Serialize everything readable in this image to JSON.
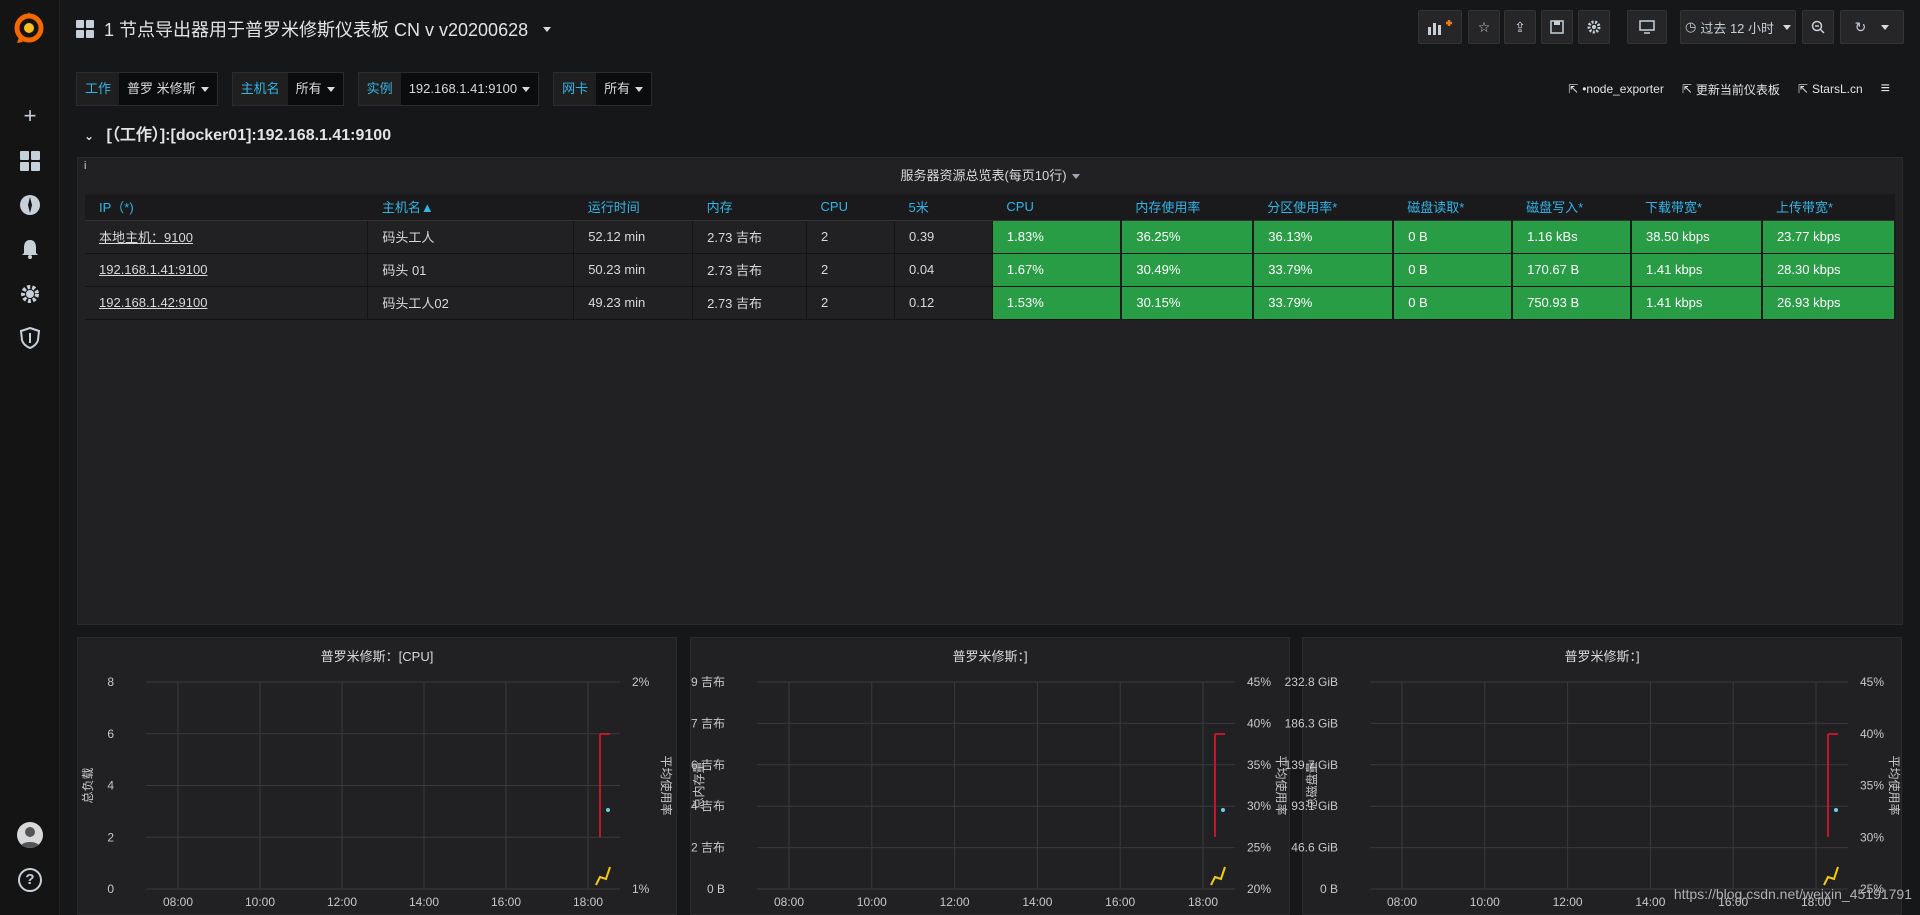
{
  "nav": {
    "title": "1 节点导出器用于普罗米修斯仪表板 CN v v20200628",
    "time_range": "过去 12 小时"
  },
  "variables": [
    {
      "label": "工作",
      "value": "普罗 米修斯"
    },
    {
      "label": "主机名",
      "value": "所有"
    },
    {
      "label": "实例",
      "value": "192.168.1.41:9100"
    },
    {
      "label": "网卡",
      "value": "所有"
    }
  ],
  "links": {
    "node_exporter": "•node_exporter",
    "update_dashboard": "更新当前仪表板",
    "starsl": "StarsL.cn"
  },
  "row_title": "[（工作）]:[docker01]:192.168.1.41:9100",
  "table_panel": {
    "title": "服务器资源总览表(每页10行)",
    "info_icon": "i",
    "headers": [
      "IP（*)",
      "主机名▲",
      "运行时间",
      "内存",
      "CPU",
      "5米",
      "CPU",
      "内存使用率",
      "分区使用率*",
      "磁盘读取*",
      "磁盘写入*",
      "下载带宽*",
      "上传带宽*"
    ],
    "rows": [
      [
        "本地主机：9100",
        "码头工人",
        "52.12 min",
        "2.73 吉布",
        "2",
        "0.39",
        "1.83%",
        "36.25%",
        "36.13%",
        "0 B",
        "1.16 kBs",
        "38.50 kbps",
        "23.77 kbps"
      ],
      [
        "192.168.1.41:9100",
        "码头 01",
        "50.23 min",
        "2.73 吉布",
        "2",
        "0.04",
        "1.67%",
        "30.49%",
        "33.79%",
        "0 B",
        "170.67 B",
        "1.41 kbps",
        "28.30 kbps"
      ],
      [
        "192.168.1.42:9100",
        "码头工人02",
        "49.23 min",
        "2.73 吉布",
        "2",
        "0.12",
        "1.53%",
        "30.15%",
        "33.79%",
        "0 B",
        "750.93 B",
        "1.41 kbps",
        "26.93 kbps"
      ]
    ],
    "status_color": "#299c46"
  },
  "charts": [
    {
      "title": "普罗米修斯：[CPU]",
      "left_label": "总负载",
      "right_label": "平均使用率",
      "left_ticks": [
        "8",
        "6",
        "4",
        "2",
        "0"
      ],
      "right_ticks": [
        "2%",
        "1%"
      ],
      "x_ticks": [
        "08:00",
        "10:00",
        "12:00",
        "14:00",
        "16:00",
        "18:00"
      ]
    },
    {
      "title": "普罗米修斯：]",
      "left_label": "总内存量",
      "right_label": "平均使用率",
      "left_ticks": [
        "9 吉布",
        "7 吉布",
        "6 吉布",
        "4 吉布",
        "2 吉布",
        "0 B"
      ],
      "right_ticks": [
        "45%",
        "40%",
        "35%",
        "30%",
        "25%",
        "20%"
      ],
      "x_ticks": [
        "08:00",
        "10:00",
        "12:00",
        "14:00",
        "16:00",
        "18:00"
      ]
    },
    {
      "title": "普罗米修斯：]",
      "left_label": "总磁盘量",
      "right_label": "平均使用率",
      "left_ticks": [
        "232.8 GiB",
        "186.3 GiB",
        "139.7 GiB",
        "93.1 GiB",
        "46.6 GiB",
        "0 B"
      ],
      "right_ticks": [
        "45%",
        "40%",
        "35%",
        "30%",
        "25%"
      ],
      "x_ticks": [
        "08:00",
        "10:00",
        "12:00",
        "14:00",
        "16:00",
        "18:00"
      ]
    }
  ],
  "watermark": "https://blog.csdn.net/weixin_45191791",
  "colors": {
    "red": "#c4162a",
    "yellow": "#f2cc0c",
    "cyan": "#5794f2"
  }
}
